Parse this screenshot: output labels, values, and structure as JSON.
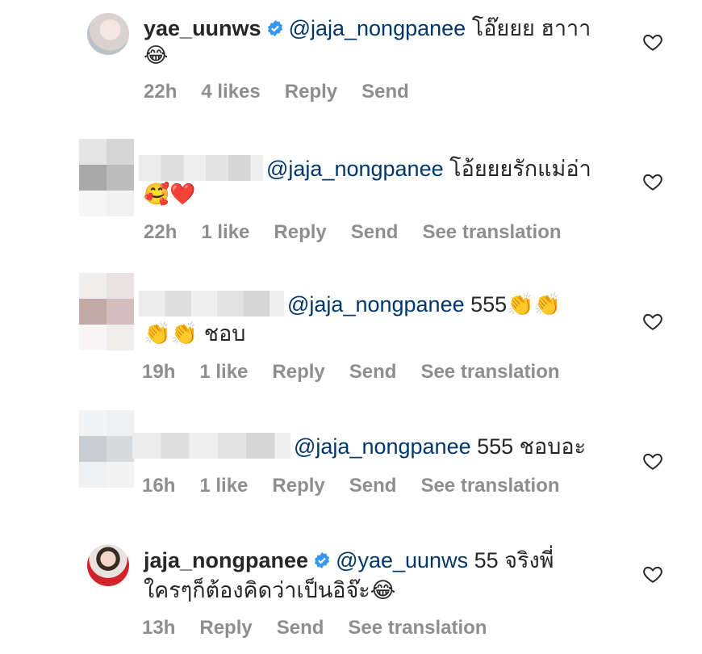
{
  "comments": [
    {
      "username": "yae_uunws",
      "mention": "@jaja_nongpanee",
      "text": "โอ๊ยยย ฮาาา",
      "text2": "😂",
      "time": "22h",
      "likes": "4 likes",
      "reply": "Reply",
      "send": "Send"
    },
    {
      "mention": "@jaja_nongpanee",
      "text": "โอ้ยยยรักแม่อ่า",
      "text2": "🥰❤️",
      "time": "22h",
      "likes": "1 like",
      "reply": "Reply",
      "send": "Send",
      "translate": "See translation"
    },
    {
      "mention": "@jaja_nongpanee",
      "text": "555👏👏",
      "text2": "👏👏 ชอบ",
      "time": "19h",
      "likes": "1 like",
      "reply": "Reply",
      "send": "Send",
      "translate": "See translation"
    },
    {
      "mention": "@jaja_nongpanee",
      "text": "555 ชอบอะ",
      "time": "16h",
      "likes": "1 like",
      "reply": "Reply",
      "send": "Send",
      "translate": "See translation"
    },
    {
      "username": "jaja_nongpanee",
      "mention": "@yae_uunws",
      "text": "55 จริงพี่",
      "text2": "ใครๆก็ต้องคิดว่าเป็นอิจ๊ะ😂",
      "time": "13h",
      "reply": "Reply",
      "send": "Send",
      "translate": "See translation"
    }
  ],
  "colors": {
    "mention": "#00376b",
    "meta": "#8e8e8e",
    "verified": "#3897f0"
  },
  "icons": {
    "verified": "verified-badge-icon",
    "like": "heart-icon"
  }
}
